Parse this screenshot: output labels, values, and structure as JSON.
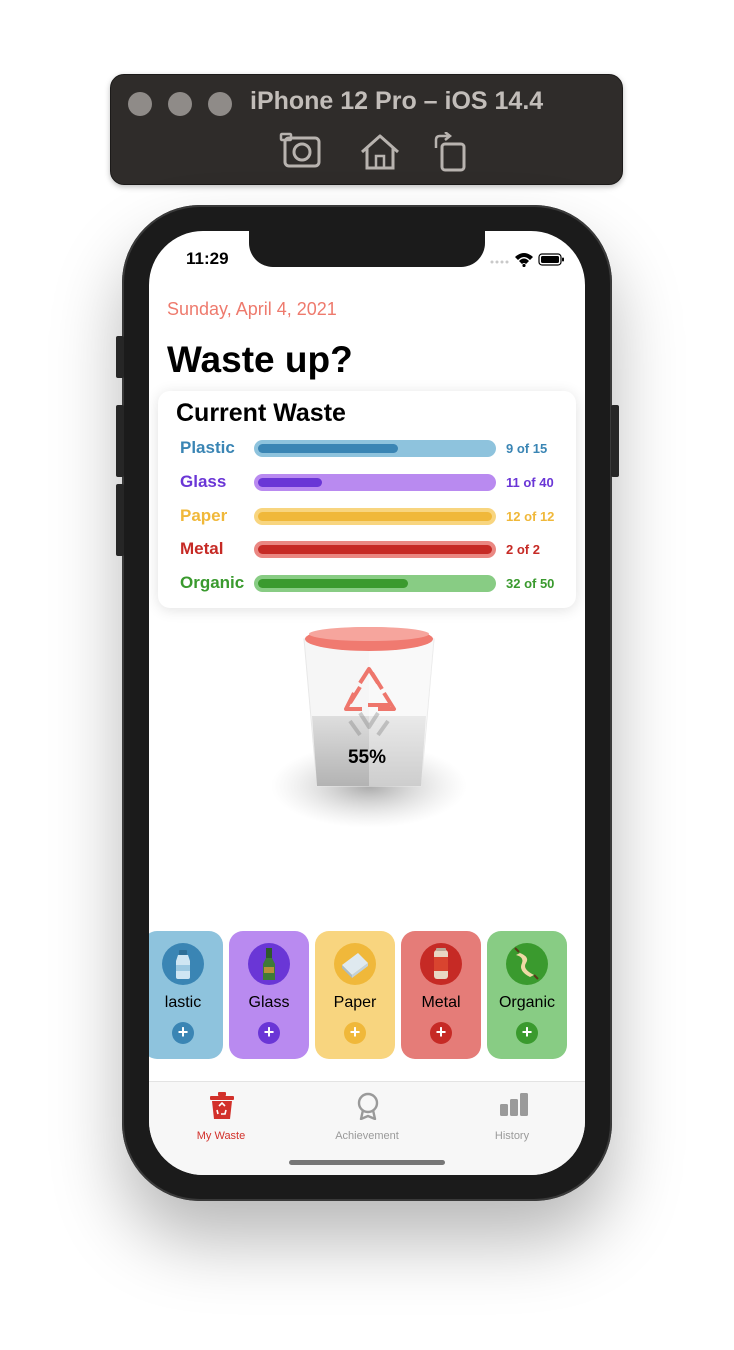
{
  "simulator": {
    "title": "iPhone 12 Pro – iOS 14.4",
    "tools": [
      "screenshot-icon",
      "home-icon",
      "rotate-icon"
    ]
  },
  "status_bar": {
    "time": "11:29"
  },
  "header": {
    "date": "Sunday, April 4, 2021",
    "title": "Waste up?"
  },
  "current_waste": {
    "title": "Current Waste",
    "items": [
      {
        "name": "Plastic",
        "count": "9 of 15",
        "fill": 0.6,
        "color": "#3a85b4",
        "track": "#8ec3dd"
      },
      {
        "name": "Glass",
        "count": "11 of 40",
        "fill": 0.275,
        "color": "#6a36d6",
        "track": "#b98af0"
      },
      {
        "name": "Paper",
        "count": "12 of 12",
        "fill": 1.0,
        "color": "#f0b83a",
        "track": "#f8d57f"
      },
      {
        "name": "Metal",
        "count": "2 of 2",
        "fill": 1.0,
        "color": "#c62a25",
        "track": "#ea8782"
      },
      {
        "name": "Organic",
        "count": "32 of 50",
        "fill": 0.64,
        "color": "#3a9a2e",
        "track": "#88cc84"
      }
    ]
  },
  "bin": {
    "percent": "55%"
  },
  "categories": [
    {
      "label": "Plastic",
      "visible_label": "lastic",
      "bg": "#8ec3dd",
      "accent": "#3a85b4",
      "icon": "plastic-bottle-icon"
    },
    {
      "label": "Glass",
      "bg": "#b98af0",
      "accent": "#6a36d6",
      "icon": "glass-bottle-icon"
    },
    {
      "label": "Paper",
      "bg": "#f8d57f",
      "accent": "#f0b83a",
      "icon": "paper-icon"
    },
    {
      "label": "Metal",
      "bg": "#e57c78",
      "accent": "#c62a25",
      "icon": "can-icon"
    },
    {
      "label": "Organic",
      "bg": "#88cc84",
      "accent": "#3a9a2e",
      "icon": "apple-core-icon"
    }
  ],
  "tabs": [
    {
      "label": "My Waste",
      "selected": true,
      "icon": "trash-icon"
    },
    {
      "label": "Achievement",
      "selected": false,
      "icon": "award-icon"
    },
    {
      "label": "History",
      "selected": false,
      "icon": "chart-icon"
    }
  ]
}
